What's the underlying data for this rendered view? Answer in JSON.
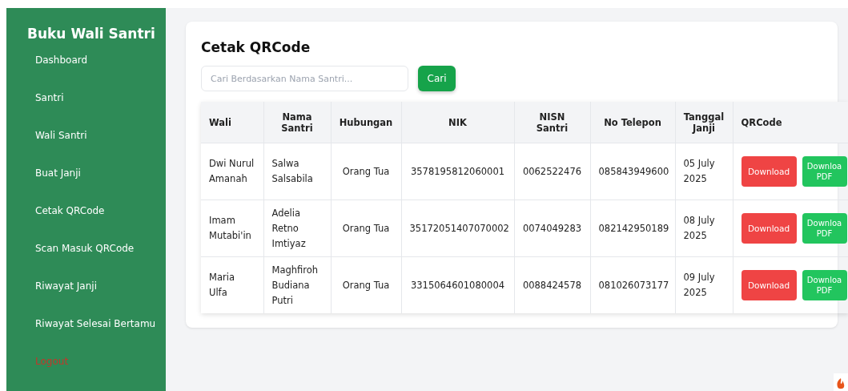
{
  "sidebar": {
    "title": "Buku Wali Santri",
    "items": [
      {
        "label": "Dashboard",
        "kind": "link"
      },
      {
        "label": "Santri",
        "kind": "link"
      },
      {
        "label": "Wali Santri",
        "kind": "link"
      },
      {
        "label": "Buat Janji",
        "kind": "link"
      },
      {
        "label": "Cetak QRCode",
        "kind": "link"
      },
      {
        "label": "Scan Masuk QRCode",
        "kind": "link"
      },
      {
        "label": "Riwayat Janji",
        "kind": "link"
      },
      {
        "label": "Riwayat Selesai Bertamu",
        "kind": "link"
      },
      {
        "label": "Logout",
        "kind": "logout"
      }
    ]
  },
  "card": {
    "title": "Cetak QRCode",
    "search": {
      "placeholder": "Cari Berdasarkan Nama Santri..."
    },
    "search_button": "Cari",
    "table": {
      "columns": [
        "Wali",
        "Nama Santri",
        "Hubungan",
        "NIK",
        "NISN Santri",
        "No Telepon",
        "Tanggal Janji",
        "QRCode"
      ],
      "rows": [
        {
          "wali": "Dwi Nurul Amanah",
          "nama_santri": "Salwa Salsabila",
          "hubungan": "Orang Tua",
          "nik": "3578195812060001",
          "nisn": "0062522476",
          "telepon": "085843949600",
          "tanggal": "05 July 2025",
          "actions": [
            "Download",
            "Downloa PDF"
          ]
        },
        {
          "wali": "Imam Mutabi'in",
          "nama_santri": "Adelia Retno Imtiyaz",
          "hubungan": "Orang Tua",
          "nik": "35172051407070002",
          "nisn": "0074049283",
          "telepon": "082142950189",
          "tanggal": "08 July 2025",
          "actions": [
            "Download",
            "Downloa PDF"
          ]
        },
        {
          "wali": "Maria Ulfa",
          "nama_santri": "Maghfiroh Budiana Putri",
          "hubungan": "Orang Tua",
          "nik": "3315064601080004",
          "nisn": "0088424578",
          "telepon": "081026073177",
          "tanggal": "09 July 2025",
          "actions": [
            "Download",
            "Downloa PDF"
          ]
        }
      ]
    }
  }
}
